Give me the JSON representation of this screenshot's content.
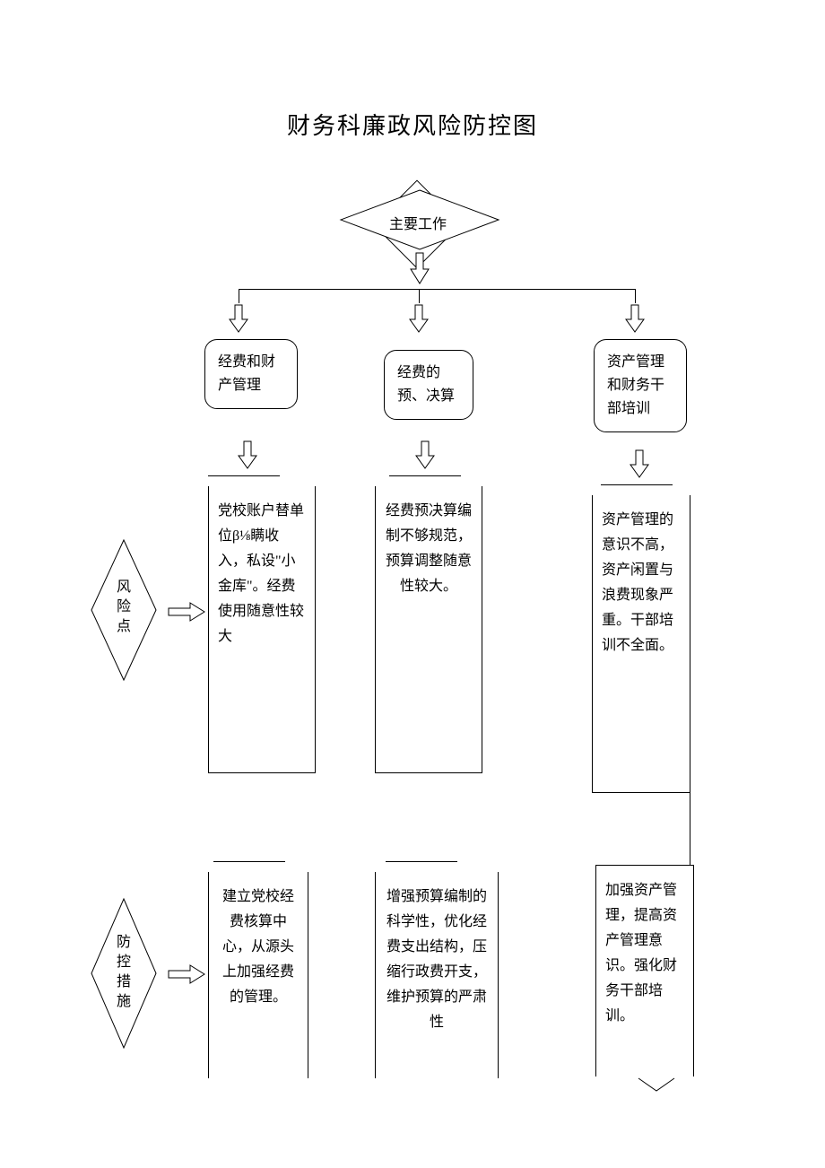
{
  "title": "财务科廉政风险防控图",
  "topNode": "主要工作",
  "labels": {
    "risk": "风险点",
    "control": "防控措施"
  },
  "columns": [
    {
      "work": "经费和财产管理",
      "risk": "党校账户替单位β⅛瞒收入，私设\"小金库\"。经费使用随意性较大",
      "control": "建立党校经费核算中心，从源头上加强经费的管理。"
    },
    {
      "work": "经费的预、决算",
      "risk": "经费预决算编制不够规范，预算调整随意性较大。",
      "control": "增强预算编制的科学性，优化经费支出结构，压缩行政费开支，维护预算的严肃性"
    },
    {
      "work": "资产管理和财务干部培训",
      "risk": "资产管理的意识不高，资产闲置与浪费现象严重。干部培训不全面。",
      "control": "加强资产管理，提高资产管理意识。强化财务干部培训。"
    }
  ]
}
